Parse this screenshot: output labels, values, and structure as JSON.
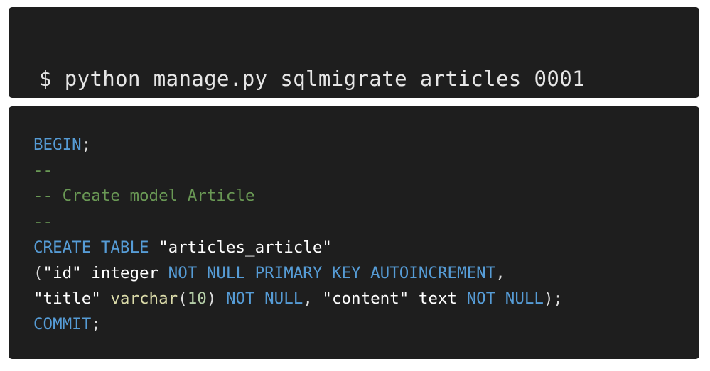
{
  "command": {
    "text": "$ python manage.py sqlmigrate articles 0001"
  },
  "sql": {
    "lines": [
      [
        {
          "t": "BEGIN",
          "c": "kw"
        },
        {
          "t": ";",
          "c": "pl"
        }
      ],
      [
        {
          "t": "--",
          "c": "cm"
        }
      ],
      [
        {
          "t": "-- Create model Article",
          "c": "cm"
        }
      ],
      [
        {
          "t": "--",
          "c": "cm"
        }
      ],
      [
        {
          "t": "CREATE TABLE ",
          "c": "kw"
        },
        {
          "t": "\"articles_article\"",
          "c": "str"
        }
      ],
      [
        {
          "t": "(",
          "c": "pl"
        },
        {
          "t": "\"id\"",
          "c": "str"
        },
        {
          "t": " integer ",
          "c": "ty"
        },
        {
          "t": "NOT NULL PRIMARY KEY AUTOINCREMENT",
          "c": "kw"
        },
        {
          "t": ",",
          "c": "pl"
        }
      ],
      [
        {
          "t": "\"title\"",
          "c": "str"
        },
        {
          "t": " ",
          "c": "pl"
        },
        {
          "t": "varchar",
          "c": "fn"
        },
        {
          "t": "(",
          "c": "pl"
        },
        {
          "t": "10",
          "c": "num"
        },
        {
          "t": ") ",
          "c": "pl"
        },
        {
          "t": "NOT NULL",
          "c": "kw"
        },
        {
          "t": ", ",
          "c": "pl"
        },
        {
          "t": "\"content\"",
          "c": "str"
        },
        {
          "t": " text ",
          "c": "ty"
        },
        {
          "t": "NOT NULL",
          "c": "kw"
        },
        {
          "t": ");",
          "c": "pl"
        }
      ],
      [
        {
          "t": "COMMIT",
          "c": "kw"
        },
        {
          "t": ";",
          "c": "pl"
        }
      ]
    ]
  },
  "colors": {
    "background": "#1e1e1e",
    "keyword": "#569cd6",
    "comment": "#6a9955",
    "string": "#ffffff",
    "function": "#dcdcaa",
    "number": "#b5cea8"
  }
}
